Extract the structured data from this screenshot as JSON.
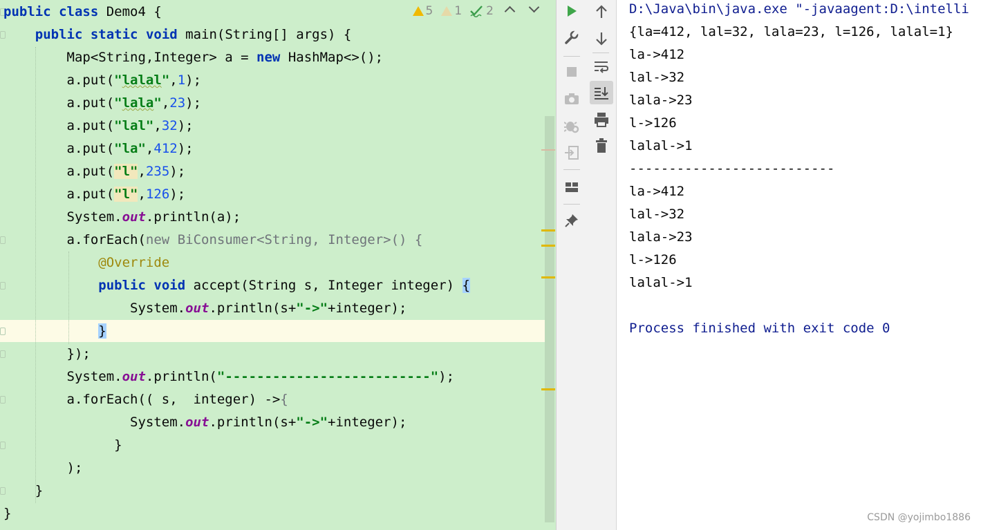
{
  "editor": {
    "inspections": {
      "warnings": "5",
      "weak_warnings": "1",
      "typos": "2"
    },
    "code_lines": [
      "public class Demo4 {",
      "    public static void main(String[] args) {",
      "        Map<String,Integer> a = new HashMap<>();",
      "        a.put(\"lalal\",1);",
      "        a.put(\"lala\",23);",
      "        a.put(\"lal\",32);",
      "        a.put(\"la\",412);",
      "        a.put(\"l\",235);",
      "        a.put(\"l\",126);",
      "        System.out.println(a);",
      "        a.forEach(new BiConsumer<String, Integer>() {",
      "            @Override",
      "            public void accept(String s, Integer integer) {",
      "                System.out.println(s+\"->\"+integer);",
      "            }",
      "        });",
      "        System.out.println(\"--------------------------\");",
      "        a.forEach(( s,  integer) ->{",
      "                System.out.println(s+\"->\"+integer);",
      "              }",
      "        );",
      "    }",
      "}"
    ]
  },
  "console": {
    "lines": [
      "D:\\Java\\bin\\java.exe \"-javaagent:D:\\intelli",
      "{la=412, lal=32, lala=23, l=126, lalal=1}",
      "la->412",
      "lal->32",
      "lala->23",
      "l->126",
      "lalal->1",
      "--------------------------",
      "la->412",
      "lal->32",
      "lala->23",
      "l->126",
      "lalal->1",
      "",
      "Process finished with exit code 0"
    ]
  },
  "watermark": "CSDN @yojimbo1886",
  "colors": {
    "editor_bg": "#cdeecb",
    "keyword": "#0033b3",
    "string": "#067d17",
    "number": "#1750eb",
    "static_field": "#871094",
    "annotation": "#9e880d",
    "console_blue": "#0f1d8f",
    "run_green": "#3fa64a"
  },
  "icons": [
    "run-icon",
    "wrench-icon",
    "stop-icon",
    "camera-icon",
    "debug-settings-icon",
    "restore-layout-icon",
    "layout-icon",
    "pin-icon",
    "up-arrow-icon",
    "down-arrow-icon",
    "soft-wrap-icon",
    "scroll-to-end-icon",
    "print-icon",
    "trash-icon"
  ]
}
